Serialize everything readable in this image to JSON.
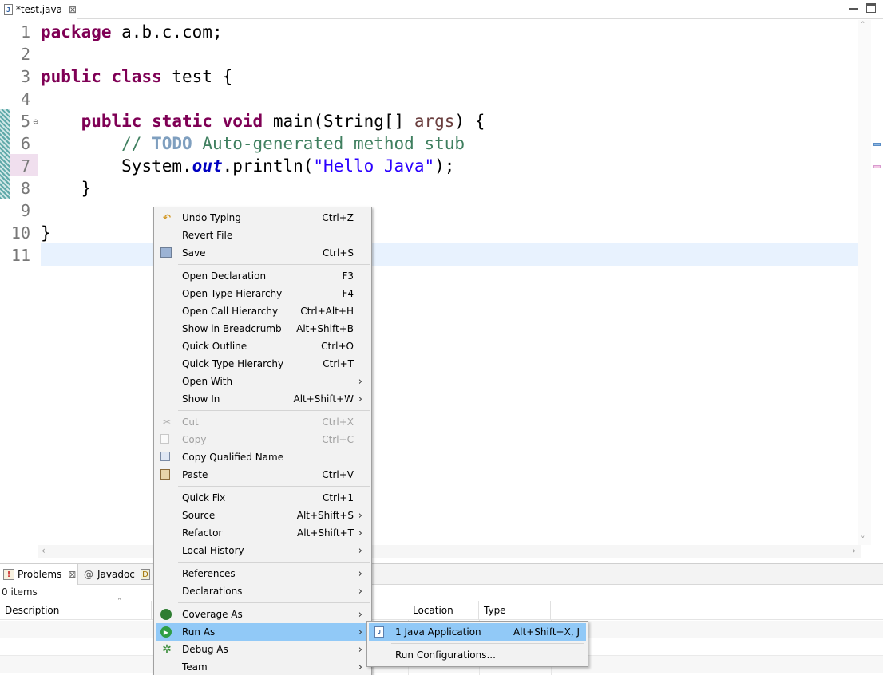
{
  "editor_tab": {
    "title": "*test.java",
    "icon": "java-file-icon",
    "close": "⊠"
  },
  "code": {
    "lines": [
      "1",
      "2",
      "3",
      "4",
      "5",
      "6",
      "7",
      "8",
      "9",
      "10",
      "11"
    ],
    "line1": {
      "kw": "package",
      "rest": " a.b.c.com;"
    },
    "line3": {
      "kw1": "public",
      "kw2": "class",
      "rest": " test {"
    },
    "line5": {
      "kw1": "public",
      "kw2": "static",
      "kw3": "void",
      "before_param": " main(String[] ",
      "param": "args",
      "after": ") {"
    },
    "line6": {
      "slashes": "// ",
      "todo": "TODO",
      "text": " Auto-generated method stub"
    },
    "line7": {
      "obj": "System.",
      "field": "out",
      "call": ".println(",
      "str": "\"Hello Java\"",
      "end": ");"
    },
    "line8": "}",
    "line10": "}"
  },
  "panel": {
    "tabs": [
      {
        "label": "Problems",
        "close": "⊠"
      },
      {
        "label": "Javadoc"
      }
    ],
    "items_count": "0 items",
    "columns": {
      "description": "Description",
      "location": "Location",
      "type": "Type"
    }
  },
  "context_menu": {
    "items": [
      {
        "label": "Undo Typing",
        "accel": "Ctrl+Z",
        "icon": "undo-icon"
      },
      {
        "label": "Revert File"
      },
      {
        "label": "Save",
        "accel": "Ctrl+S",
        "icon": "save-icon"
      },
      {
        "label": "Open Declaration",
        "accel": "F3"
      },
      {
        "label": "Open Type Hierarchy",
        "accel": "F4"
      },
      {
        "label": "Open Call Hierarchy",
        "accel": "Ctrl+Alt+H"
      },
      {
        "label": "Show in Breadcrumb",
        "accel": "Alt+Shift+B"
      },
      {
        "label": "Quick Outline",
        "accel": "Ctrl+O"
      },
      {
        "label": "Quick Type Hierarchy",
        "accel": "Ctrl+T"
      },
      {
        "label": "Open With"
      },
      {
        "label": "Show In",
        "accel": "Alt+Shift+W"
      },
      {
        "label": "Cut",
        "accel": "Ctrl+X",
        "icon": "scissors-icon",
        "disabled": true
      },
      {
        "label": "Copy",
        "accel": "Ctrl+C",
        "icon": "copy-icon",
        "disabled": true
      },
      {
        "label": "Copy Qualified Name",
        "icon": "copy-qualified-name-icon"
      },
      {
        "label": "Paste",
        "accel": "Ctrl+V",
        "icon": "paste-icon"
      },
      {
        "label": "Quick Fix",
        "accel": "Ctrl+1"
      },
      {
        "label": "Source",
        "accel": "Alt+Shift+S"
      },
      {
        "label": "Refactor",
        "accel": "Alt+Shift+T"
      },
      {
        "label": "Local History"
      },
      {
        "label": "References"
      },
      {
        "label": "Declarations"
      },
      {
        "label": "Coverage As",
        "icon": "coverage-icon"
      },
      {
        "label": "Run As",
        "icon": "run-icon",
        "selected": true
      },
      {
        "label": "Debug As",
        "icon": "bug-icon"
      },
      {
        "label": "Team"
      }
    ],
    "submenu_arrow": "›"
  },
  "run_as_submenu": {
    "items": [
      {
        "label": "1 Java Application",
        "accel": "Alt+Shift+X, J",
        "icon": "java-app-icon",
        "selected": true
      },
      {
        "label": "Run Configurations..."
      }
    ]
  },
  "colors": {
    "selection": "#91c9f7",
    "keyword": "#7f0055",
    "string": "#2a00ff",
    "comment": "#3f7f5f",
    "current_line": "#e8f2fe"
  }
}
